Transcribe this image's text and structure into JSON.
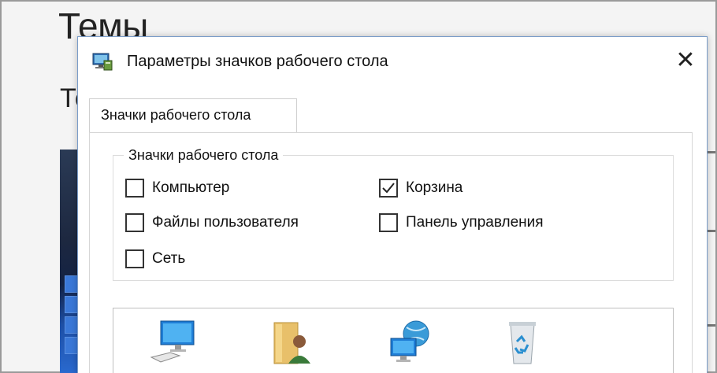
{
  "background_page": {
    "title": "Темы",
    "subtitle": "Те"
  },
  "dialog": {
    "title": "Параметры значков рабочего стола",
    "close_glyph": "✕",
    "tab_label": "Значки рабочего стола",
    "group_label": "Значки рабочего стола",
    "checkboxes": [
      {
        "label": "Компьютер",
        "checked": false
      },
      {
        "label": "Корзина",
        "checked": true
      },
      {
        "label": "Файлы пользователя",
        "checked": false
      },
      {
        "label": "Панель управления",
        "checked": false
      },
      {
        "label": "Сеть",
        "checked": false
      }
    ],
    "icons": [
      "computer-icon",
      "user-files-icon",
      "network-icon",
      "recycle-bin-icon"
    ]
  }
}
